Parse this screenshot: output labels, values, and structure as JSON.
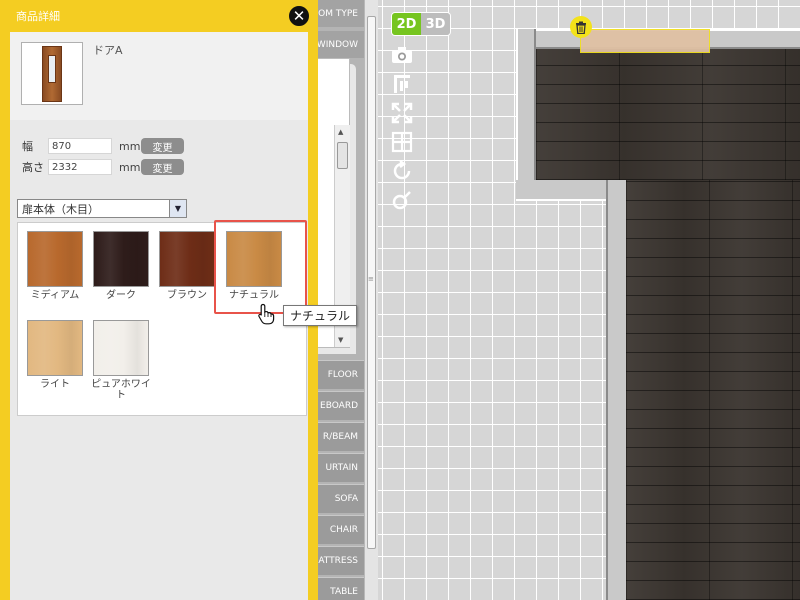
{
  "detail": {
    "title": "商品詳細",
    "close_icon": "close-icon",
    "product_name": "ドアA",
    "width_label": "幅",
    "width_value": "870",
    "height_label": "高さ",
    "height_value": "2332",
    "unit": "mm",
    "change_label": "変更",
    "part_select_value": "扉本体（木目）",
    "swatches": [
      {
        "label": "ミディアム",
        "color": "#b8692d"
      },
      {
        "label": "ダーク",
        "color": "#2e1c1a"
      },
      {
        "label": "ブラウン",
        "color": "#6e2d17"
      },
      {
        "label": "ナチュラル",
        "color": "#c98a45",
        "selected": true
      },
      {
        "label": "ライト",
        "color": "#e2b881"
      },
      {
        "label": "ピュアホワイト",
        "color": "#f2efea"
      }
    ],
    "tooltip": "ナチュラル"
  },
  "categories": {
    "top": [
      "OM TYPE",
      "WINDOW"
    ],
    "bottom": [
      "FLOOR",
      "EBOARD",
      "R/BEAM",
      "URTAIN",
      "SOFA",
      "CHAIR",
      "ATTRESS",
      "TABLE"
    ]
  },
  "view_toggle": {
    "mode_2d": "2D",
    "mode_3d": "3D",
    "active": "2D"
  },
  "tools": [
    "camera-icon",
    "move-icon",
    "fullscreen-icon",
    "grid-icon",
    "rotate-icon",
    "zoom-icon"
  ],
  "colors": {
    "dialog_yellow": "#f4cd22",
    "highlight_red": "#e8534a",
    "toggle_green": "#76c51f",
    "trash_yellow": "#f3e21a"
  }
}
